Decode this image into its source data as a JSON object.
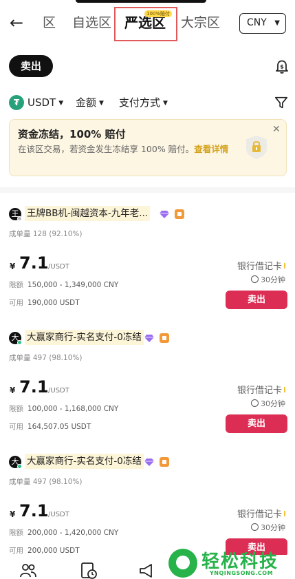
{
  "nav": {
    "back_icon": "arrow-left-icon",
    "tabs": [
      {
        "label": "区",
        "partial": true
      },
      {
        "label": "自选区"
      },
      {
        "label": "严选区",
        "active": true,
        "badge": "100%赔付"
      },
      {
        "label": "大宗区"
      }
    ],
    "currency": "CNY"
  },
  "actions": {
    "sell_label": "卖出",
    "bell_icon": "bell-dollar-icon"
  },
  "filters": {
    "coin": "USDT",
    "amount": "金额",
    "payment": "支付方式",
    "filter_icon": "funnel-icon"
  },
  "notice": {
    "title": "资金冻结，100% 赔付",
    "text": "在该区交易，若资金发生冻结享 100% 赔付。",
    "link": "查看详情"
  },
  "listings": [
    {
      "avatar": "王",
      "online": false,
      "merchant": "王牌BB机-闽越资本-九年老...",
      "orders_label": "成单量",
      "orders": "128 (92.10%)",
      "currency_symbol": "¥",
      "price": "7.1",
      "price_unit": "/USDT",
      "limit_label": "限额",
      "limit": "150,000 - 1,349,000 CNY",
      "available_label": "可用",
      "available": "190,000 USDT",
      "payment": "银行借记卡",
      "time": "30分钟",
      "button": "卖出"
    },
    {
      "avatar": "大",
      "online": true,
      "merchant": "大赢家商行-实名支付-0冻结",
      "orders_label": "成单量",
      "orders": "497 (98.10%)",
      "currency_symbol": "¥",
      "price": "7.1",
      "price_unit": "/USDT",
      "limit_label": "限额",
      "limit": "100,000 - 1,168,000 CNY",
      "available_label": "可用",
      "available": "164,507.05 USDT",
      "payment": "银行借记卡",
      "time": "30分钟",
      "button": "卖出"
    },
    {
      "avatar": "大",
      "online": true,
      "merchant": "大赢家商行-实名支付-0冻结",
      "orders_label": "成单量",
      "orders": "497 (98.10%)",
      "currency_symbol": "¥",
      "price": "7.1",
      "price_unit": "/USDT",
      "limit_label": "限额",
      "limit": "200,000 - 1,420,000 CNY",
      "available_label": "可用",
      "available": "200,000 USDT",
      "payment": "银行借记卡",
      "time": "30分钟",
      "button": "卖出"
    }
  ],
  "bottom_nav": [
    "people-icon",
    "order-clock-icon",
    "megaphone-icon"
  ],
  "watermark": {
    "text": "轻松科技",
    "sub": "YNQINGSONG.COM"
  },
  "colors": {
    "sell": "#dc2d54",
    "accent": "#d4a21c",
    "usdt": "#26a17b"
  }
}
